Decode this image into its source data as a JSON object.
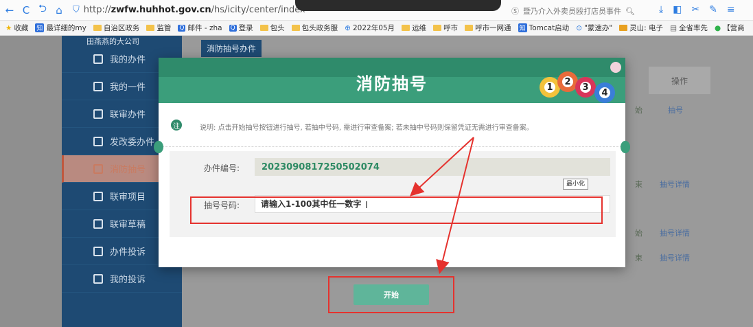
{
  "browser": {
    "url_prefix": "http://",
    "url_host": "zwfw.huhhot.gov.cn",
    "url_path": "/hs/icity/center/index",
    "search_hint": "暨乃介入外卖员殴打店员事件",
    "bookmarks": [
      "收藏",
      "最详细的my",
      "自治区政务",
      "监管",
      "邮件 - zha",
      "登录",
      "包头",
      "包头政务服",
      "2022年05月",
      "运维",
      "呼市",
      "呼市一网通",
      "Tomcat启动",
      "\"蒙速办\"",
      "灵山: 电子",
      "全省率先",
      "【营商"
    ]
  },
  "sidebar": {
    "company": "田燕燕的大公司",
    "items": [
      {
        "label": "我的办件"
      },
      {
        "label": "我的一件"
      },
      {
        "label": "联审办件"
      },
      {
        "label": "发改委办件"
      },
      {
        "label": "消防抽号"
      },
      {
        "label": "联审项目"
      },
      {
        "label": "联审草稿"
      },
      {
        "label": "办件投诉"
      },
      {
        "label": "我的投诉"
      }
    ]
  },
  "content": {
    "tab": "消防抽号办件",
    "col_operation": "操作",
    "rows": [
      {
        "status": "始",
        "action": "抽号"
      },
      {
        "status": "束",
        "action": "抽号详情"
      },
      {
        "status": "始",
        "action": "抽号详情"
      },
      {
        "status": "束",
        "action": "抽号详情"
      }
    ]
  },
  "modal": {
    "title": "消防抽号",
    "ball_numbers": [
      "1",
      "2",
      "3",
      "4"
    ],
    "notice_icon": "注",
    "notice": "说明: 点击开始抽号按钮进行抽号, 若抽中号码, 需进行审查备案; 若未抽中号码则保留凭证无需进行审查备案。",
    "case_no_label": "办件编号:",
    "case_no_value": "2023090817250502074",
    "lottery_label": "抽号号码:",
    "lottery_placeholder": "请输入1-100其中任一数字",
    "minimize_tip": "最小化",
    "start_button": "开始"
  },
  "colors": {
    "primary_green": "#3b9e7b",
    "sidebar_blue": "#1e4a73",
    "annotation_red": "#e5322e"
  }
}
